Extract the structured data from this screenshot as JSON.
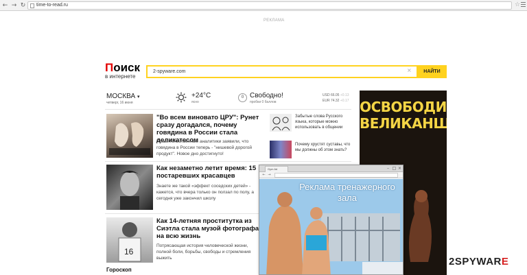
{
  "browser": {
    "back_icon": "back-arrow-icon",
    "forward_icon": "forward-arrow-icon",
    "reload_icon": "reload-icon",
    "url": "time-to-read.ru",
    "star_icon": "star-icon",
    "menu_icon": "menu-icon"
  },
  "ad_label": "РЕКЛАМА",
  "logo": {
    "main": "оиск",
    "first_letter": "П",
    "sub": "в интернете"
  },
  "search": {
    "value": "2-spyware.com",
    "clear_glyph": "×",
    "button": "НАЙТИ"
  },
  "weather": {
    "city": "МОСКВА",
    "city_arrow": "▾",
    "date": "четверг, 16 июня",
    "temp": "+24°C",
    "condition": "ясно",
    "traffic_level": "0",
    "traffic_title": "Свободно!",
    "traffic_sub": "пробки 0 баллов",
    "usd_label": "USD",
    "usd": "66.05",
    "usd_delta": "+0.13",
    "eur_label": "EUR",
    "eur": "74.32",
    "eur_delta": "+0.17"
  },
  "news": [
    {
      "headline": "\"Во всем виновато ЦРУ\": Рунет сразу догадался, почему говядина в России стала деликатесом",
      "lead": "Правительственные аналитики заявили, что говядина в России теперь - \"нишевой дорогой продукт\". Новое дно достигнуто!"
    },
    {
      "headline": "Как незаметно летит время: 15 постаревших красавцев",
      "lead": "Знаете же такой «эффект соседских детей» - кажется, что вчера только он ползал по полу, а сегодня уже закончил школу"
    },
    {
      "headline": "Как 14-летняя проститутка из Сиэтла стала музой фотографа на всю жизнь",
      "lead": "Потрясающая история человеческой жизни, полной боли, борьбы, свободы и стремления выжить"
    }
  ],
  "side_news": [
    {
      "text": "Забытые слова Русского языка, которые можно использовать в общении"
    },
    {
      "text": "Почему хрустят суставы, что мы должны об этом знать?"
    }
  ],
  "section_title": "Гороскоп",
  "banner": {
    "title": "ОСВОБОДИ ВЕЛИКАНШУ"
  },
  "popup": {
    "tab": "Gym Ad",
    "url": "",
    "ad_text": "Реклама тренажерного зала",
    "minimize": "–",
    "maximize": "□",
    "close": "×"
  },
  "watermark": {
    "num": "2",
    "text": "SPYWAR",
    "end": "E"
  },
  "colors": {
    "search_accent": "#ffd21f",
    "logo_red": "#e30000",
    "banner_text": "#f4d545"
  }
}
